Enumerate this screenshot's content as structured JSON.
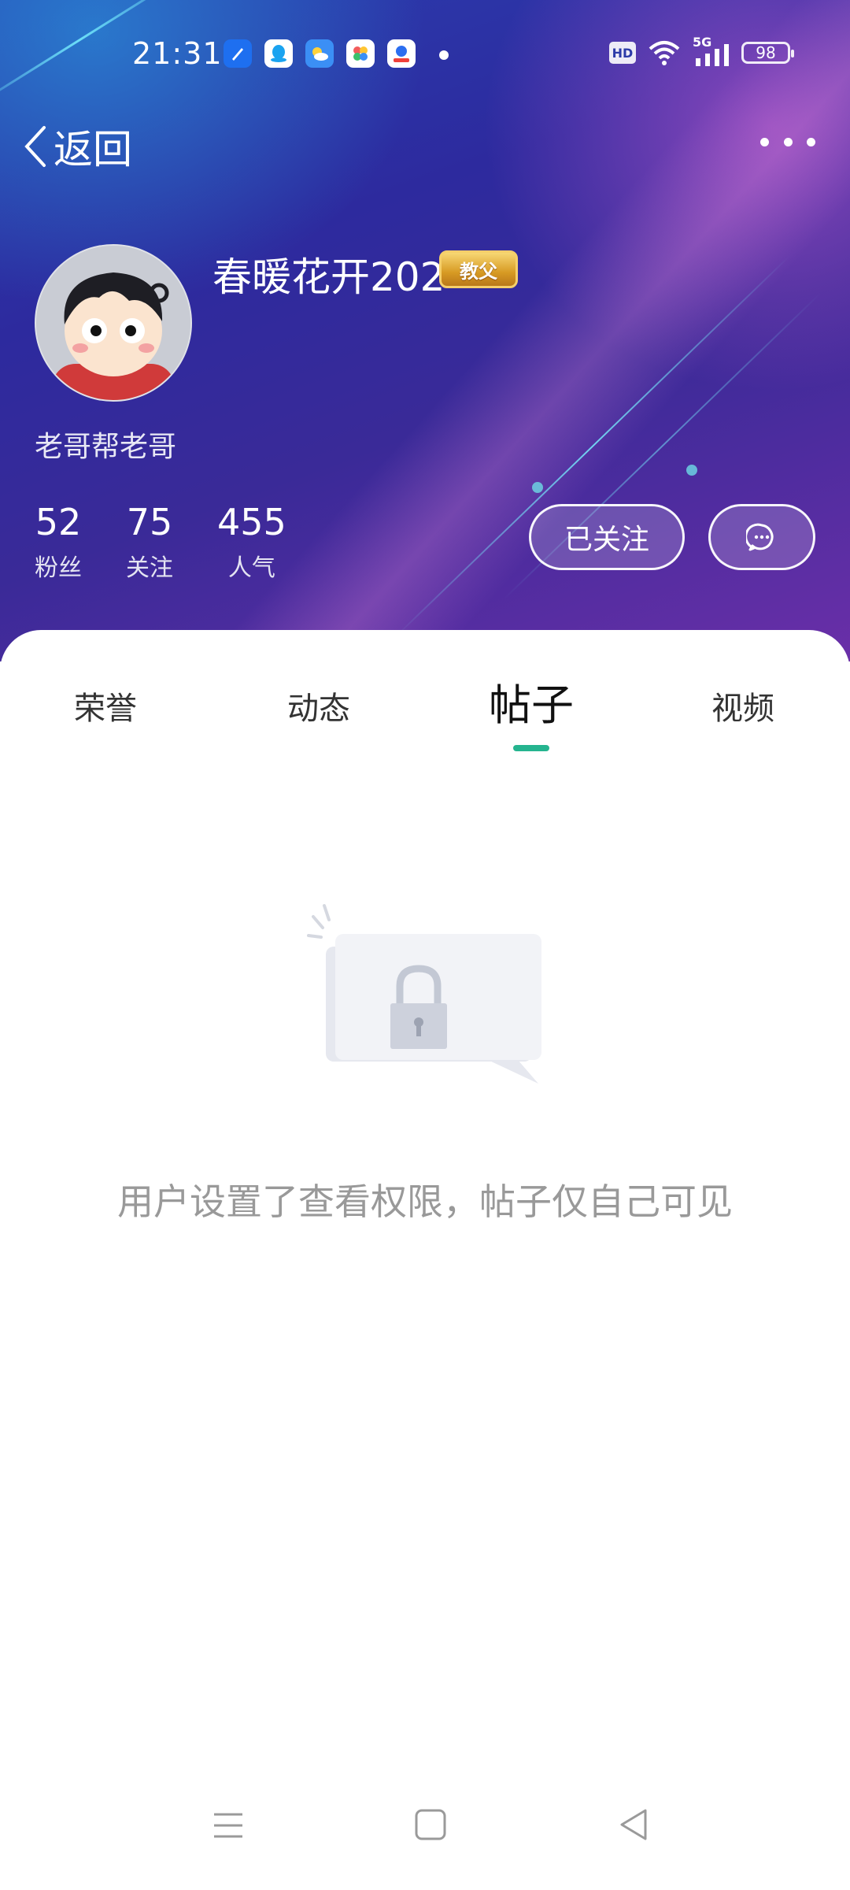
{
  "status_bar": {
    "time": "21:31",
    "app_icons": [
      "browser-icon",
      "qq-icon",
      "weather-icon",
      "photos-icon",
      "video-icon"
    ],
    "hd_label": "HD",
    "network_label": "5G",
    "battery_level": "98"
  },
  "nav": {
    "back_label": "返回"
  },
  "profile": {
    "username": "春暖花开202",
    "rank_badge": "教父",
    "bio": "老哥帮老哥",
    "stats": [
      {
        "value": "52",
        "label": "粉丝"
      },
      {
        "value": "75",
        "label": "关注"
      },
      {
        "value": "455",
        "label": "人气"
      }
    ],
    "follow_label": "已关注"
  },
  "tabs": [
    {
      "label": "荣誉",
      "active": false
    },
    {
      "label": "动态",
      "active": false
    },
    {
      "label": "帖子",
      "active": true
    },
    {
      "label": "视频",
      "active": false
    }
  ],
  "empty_state": {
    "message": "用户设置了查看权限，帖子仅自己可见"
  },
  "colors": {
    "accent": "#25b48f",
    "header_start": "#2a3fb0",
    "header_end": "#6a2fa8",
    "badge_gold": "#d79a23"
  },
  "bottom_nav": [
    "menu-icon",
    "home-icon",
    "back-triangle-icon"
  ]
}
